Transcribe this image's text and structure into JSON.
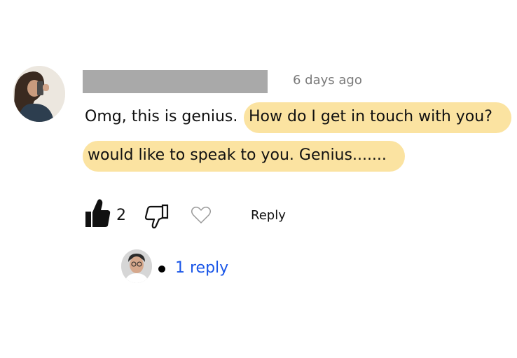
{
  "comment": {
    "timestamp": "6 days ago",
    "text_plain": "Omg, this is genius.",
    "text_highlight_1": "How do I get in touch with you?",
    "text_highlight_2": "would like to speak to you. Genius.......",
    "highlight_color": "#fbe3a1"
  },
  "actions": {
    "like_count": "2",
    "reply_label": "Reply"
  },
  "replies": {
    "link_label": "1 reply",
    "link_color": "#1a56e8"
  },
  "icons": [
    "thumbs-up-icon",
    "thumbs-down-icon",
    "heart-icon"
  ]
}
